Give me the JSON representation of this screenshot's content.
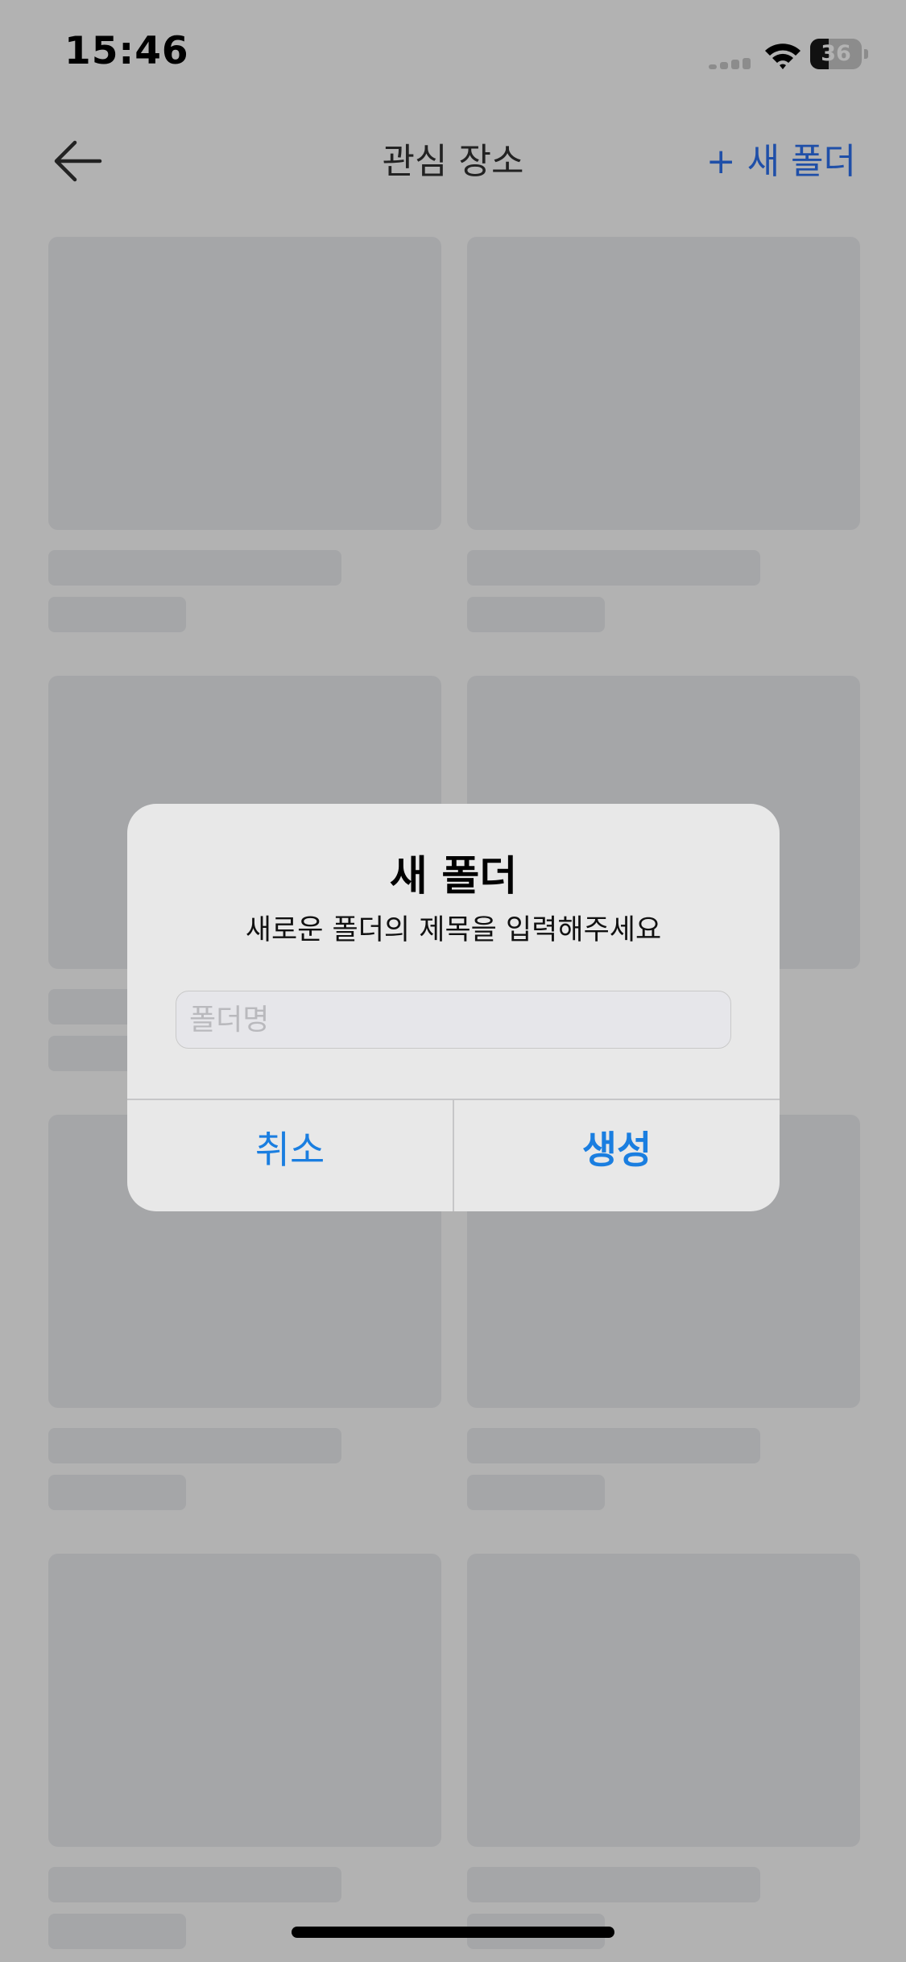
{
  "status_bar": {
    "time": "15:46",
    "battery_percent": "36",
    "battery_level": 0.36,
    "icons": [
      "cellular-signal-icon",
      "wifi-icon",
      "battery-icon"
    ]
  },
  "nav": {
    "back_icon": "arrow-left-icon",
    "title": "관심 장소",
    "new_folder_label": "+ 새 폴더"
  },
  "grid": {
    "placeholder_cards": 8,
    "columns": 2
  },
  "dialog": {
    "title": "새 폴더",
    "message": "새로운 폴더의 제목을 입력해주세요",
    "input_value": "",
    "input_placeholder": "폴더명",
    "cancel_label": "취소",
    "create_label": "생성"
  },
  "colors": {
    "dim_background": "#b2b2b2",
    "skeleton": "#a5a6a8",
    "dialog_background": "#e8e8e8",
    "accent_blue": "#1a7ee0",
    "nav_link_blue": "#1f4fa8"
  }
}
